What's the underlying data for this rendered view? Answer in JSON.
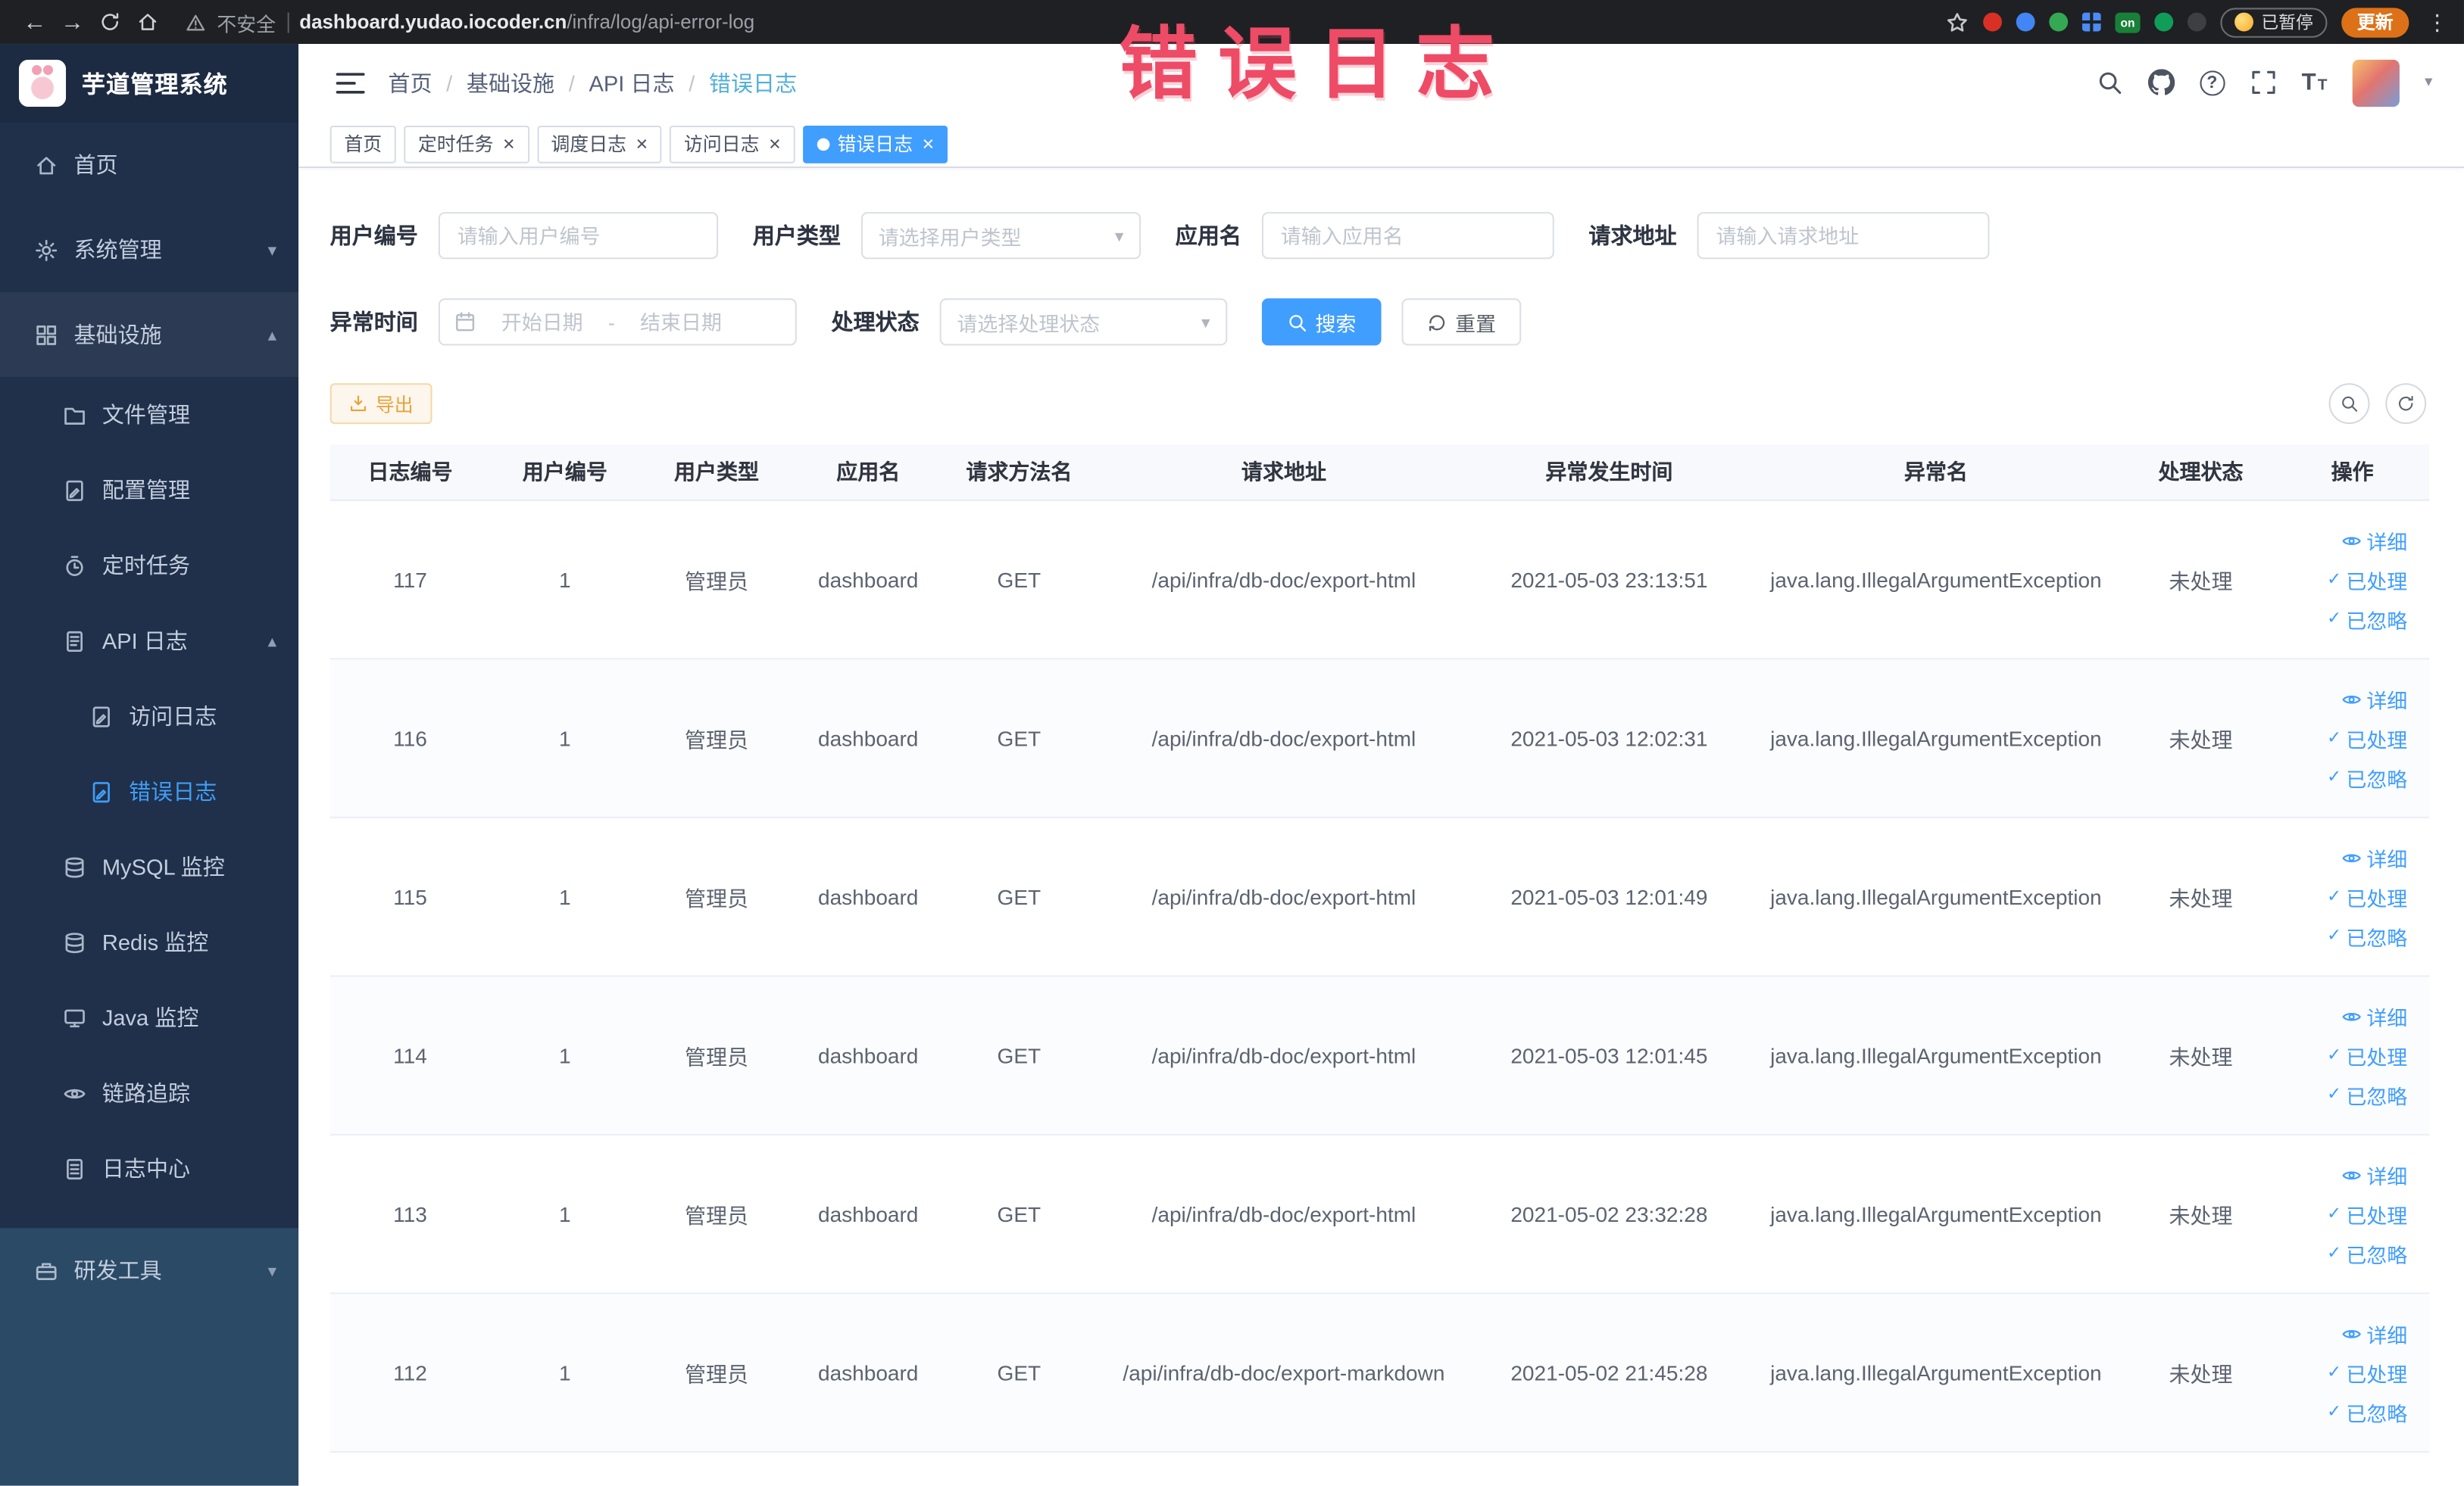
{
  "icons_map": {
    "back_arrow": "←",
    "forward_arrow": "→",
    "chevron_down": "▾",
    "chevron_up": "▴",
    "close": "×",
    "check": "✓",
    "kebab": "⋮",
    "help": "?",
    "font_large": "T",
    "font_small": "T"
  },
  "colors": {
    "accent": "#409eff",
    "warning": "#e6a23c",
    "annotation": "#ee4b66",
    "sidebar_bg": "#20304a"
  },
  "browser": {
    "security_label": "不安全",
    "url_domain": "dashboard.yudao.iocoder.cn",
    "url_path": "/infra/log/api-error-log",
    "extension_on_label": "on",
    "paused_label": "已暂停",
    "update_label": "更新"
  },
  "annotation": {
    "text": "错误日志",
    "color": "#ee4b66"
  },
  "header": {
    "breadcrumb": [
      "首页",
      "基础设施",
      "API 日志",
      "错误日志"
    ],
    "breadcrumb_separator": "/"
  },
  "sidebar": {
    "logo_title": "芋道管理系统",
    "items": [
      {
        "key": "home",
        "label": "首页",
        "icon": "home-icon",
        "level": 1
      },
      {
        "key": "system",
        "label": "系统管理",
        "icon": "gear-icon",
        "level": 1,
        "chevron": "down"
      },
      {
        "key": "infra",
        "label": "基础设施",
        "icon": "grid-icon",
        "level": 1,
        "chevron": "up",
        "highlighted": true
      },
      {
        "key": "file",
        "label": "文件管理",
        "icon": "folder-icon",
        "level": 2
      },
      {
        "key": "config",
        "label": "配置管理",
        "icon": "doc-edit-icon",
        "level": 2
      },
      {
        "key": "job",
        "label": "定时任务",
        "icon": "timer-icon",
        "level": 2
      },
      {
        "key": "api-log",
        "label": "API 日志",
        "icon": "doc-icon",
        "level": 2,
        "chevron": "up"
      },
      {
        "key": "access-log",
        "label": "访问日志",
        "icon": "doc-edit-icon",
        "level": 3
      },
      {
        "key": "error-log",
        "label": "错误日志",
        "icon": "doc-edit-icon",
        "level": 3,
        "active": true
      },
      {
        "key": "mysql",
        "label": "MySQL 监控",
        "icon": "database-icon",
        "level": 2
      },
      {
        "key": "redis",
        "label": "Redis 监控",
        "icon": "database-icon",
        "level": 2
      },
      {
        "key": "java",
        "label": "Java 监控",
        "icon": "monitor-icon",
        "level": 2
      },
      {
        "key": "tracer",
        "label": "链路追踪",
        "icon": "eye-icon",
        "level": 2
      },
      {
        "key": "log-center",
        "label": "日志中心",
        "icon": "doc-lines-icon",
        "level": 2
      },
      {
        "key": "dev-tools",
        "label": "研发工具",
        "icon": "toolbox-icon",
        "level": 1,
        "chevron": "down",
        "section": "light"
      }
    ]
  },
  "tabs": [
    {
      "key": "home",
      "label": "首页",
      "closable": false,
      "active": false
    },
    {
      "key": "job",
      "label": "定时任务",
      "closable": true,
      "active": false
    },
    {
      "key": "job-log",
      "label": "调度日志",
      "closable": true,
      "active": false
    },
    {
      "key": "access-log",
      "label": "访问日志",
      "closable": true,
      "active": false
    },
    {
      "key": "error-log",
      "label": "错误日志",
      "closable": true,
      "active": true
    }
  ],
  "filters": {
    "user_id": {
      "label": "用户编号",
      "placeholder": "请输入用户编号",
      "value": ""
    },
    "user_type": {
      "label": "用户类型",
      "placeholder": "请选择用户类型"
    },
    "app_name": {
      "label": "应用名",
      "placeholder": "请输入应用名",
      "value": ""
    },
    "request_url": {
      "label": "请求地址",
      "placeholder": "请输入请求地址",
      "value": ""
    },
    "exception_time": {
      "label": "异常时间",
      "start_placeholder": "开始日期",
      "separator": "-",
      "end_placeholder": "结束日期"
    },
    "process_status": {
      "label": "处理状态",
      "placeholder": "请选择处理状态"
    },
    "search_label": "搜索",
    "reset_label": "重置"
  },
  "toolbar": {
    "export_label": "导出"
  },
  "table": {
    "columns": [
      "日志编号",
      "用户编号",
      "用户类型",
      "应用名",
      "请求方法名",
      "请求地址",
      "异常发生时间",
      "异常名",
      "处理状态",
      "操作"
    ],
    "action_labels": [
      "详细",
      "已处理",
      "已忽略"
    ],
    "rows": [
      {
        "id": "117",
        "user_id": "1",
        "user_type": "管理员",
        "app": "dashboard",
        "method": "GET",
        "url": "/api/infra/db-doc/export-html",
        "time": "2021-05-03 23:13:51",
        "exception": "java.lang.IllegalArgumentException",
        "status": "未处理"
      },
      {
        "id": "116",
        "user_id": "1",
        "user_type": "管理员",
        "app": "dashboard",
        "method": "GET",
        "url": "/api/infra/db-doc/export-html",
        "time": "2021-05-03 12:02:31",
        "exception": "java.lang.IllegalArgumentException",
        "status": "未处理"
      },
      {
        "id": "115",
        "user_id": "1",
        "user_type": "管理员",
        "app": "dashboard",
        "method": "GET",
        "url": "/api/infra/db-doc/export-html",
        "time": "2021-05-03 12:01:49",
        "exception": "java.lang.IllegalArgumentException",
        "status": "未处理"
      },
      {
        "id": "114",
        "user_id": "1",
        "user_type": "管理员",
        "app": "dashboard",
        "method": "GET",
        "url": "/api/infra/db-doc/export-html",
        "time": "2021-05-03 12:01:45",
        "exception": "java.lang.IllegalArgumentException",
        "status": "未处理"
      },
      {
        "id": "113",
        "user_id": "1",
        "user_type": "管理员",
        "app": "dashboard",
        "method": "GET",
        "url": "/api/infra/db-doc/export-html",
        "time": "2021-05-02 23:32:28",
        "exception": "java.lang.IllegalArgumentException",
        "status": "未处理"
      },
      {
        "id": "112",
        "user_id": "1",
        "user_type": "管理员",
        "app": "dashboard",
        "method": "GET",
        "url": "/api/infra/db-doc/export-markdown",
        "time": "2021-05-02 21:45:28",
        "exception": "java.lang.IllegalArgumentException",
        "status": "未处理"
      }
    ]
  }
}
